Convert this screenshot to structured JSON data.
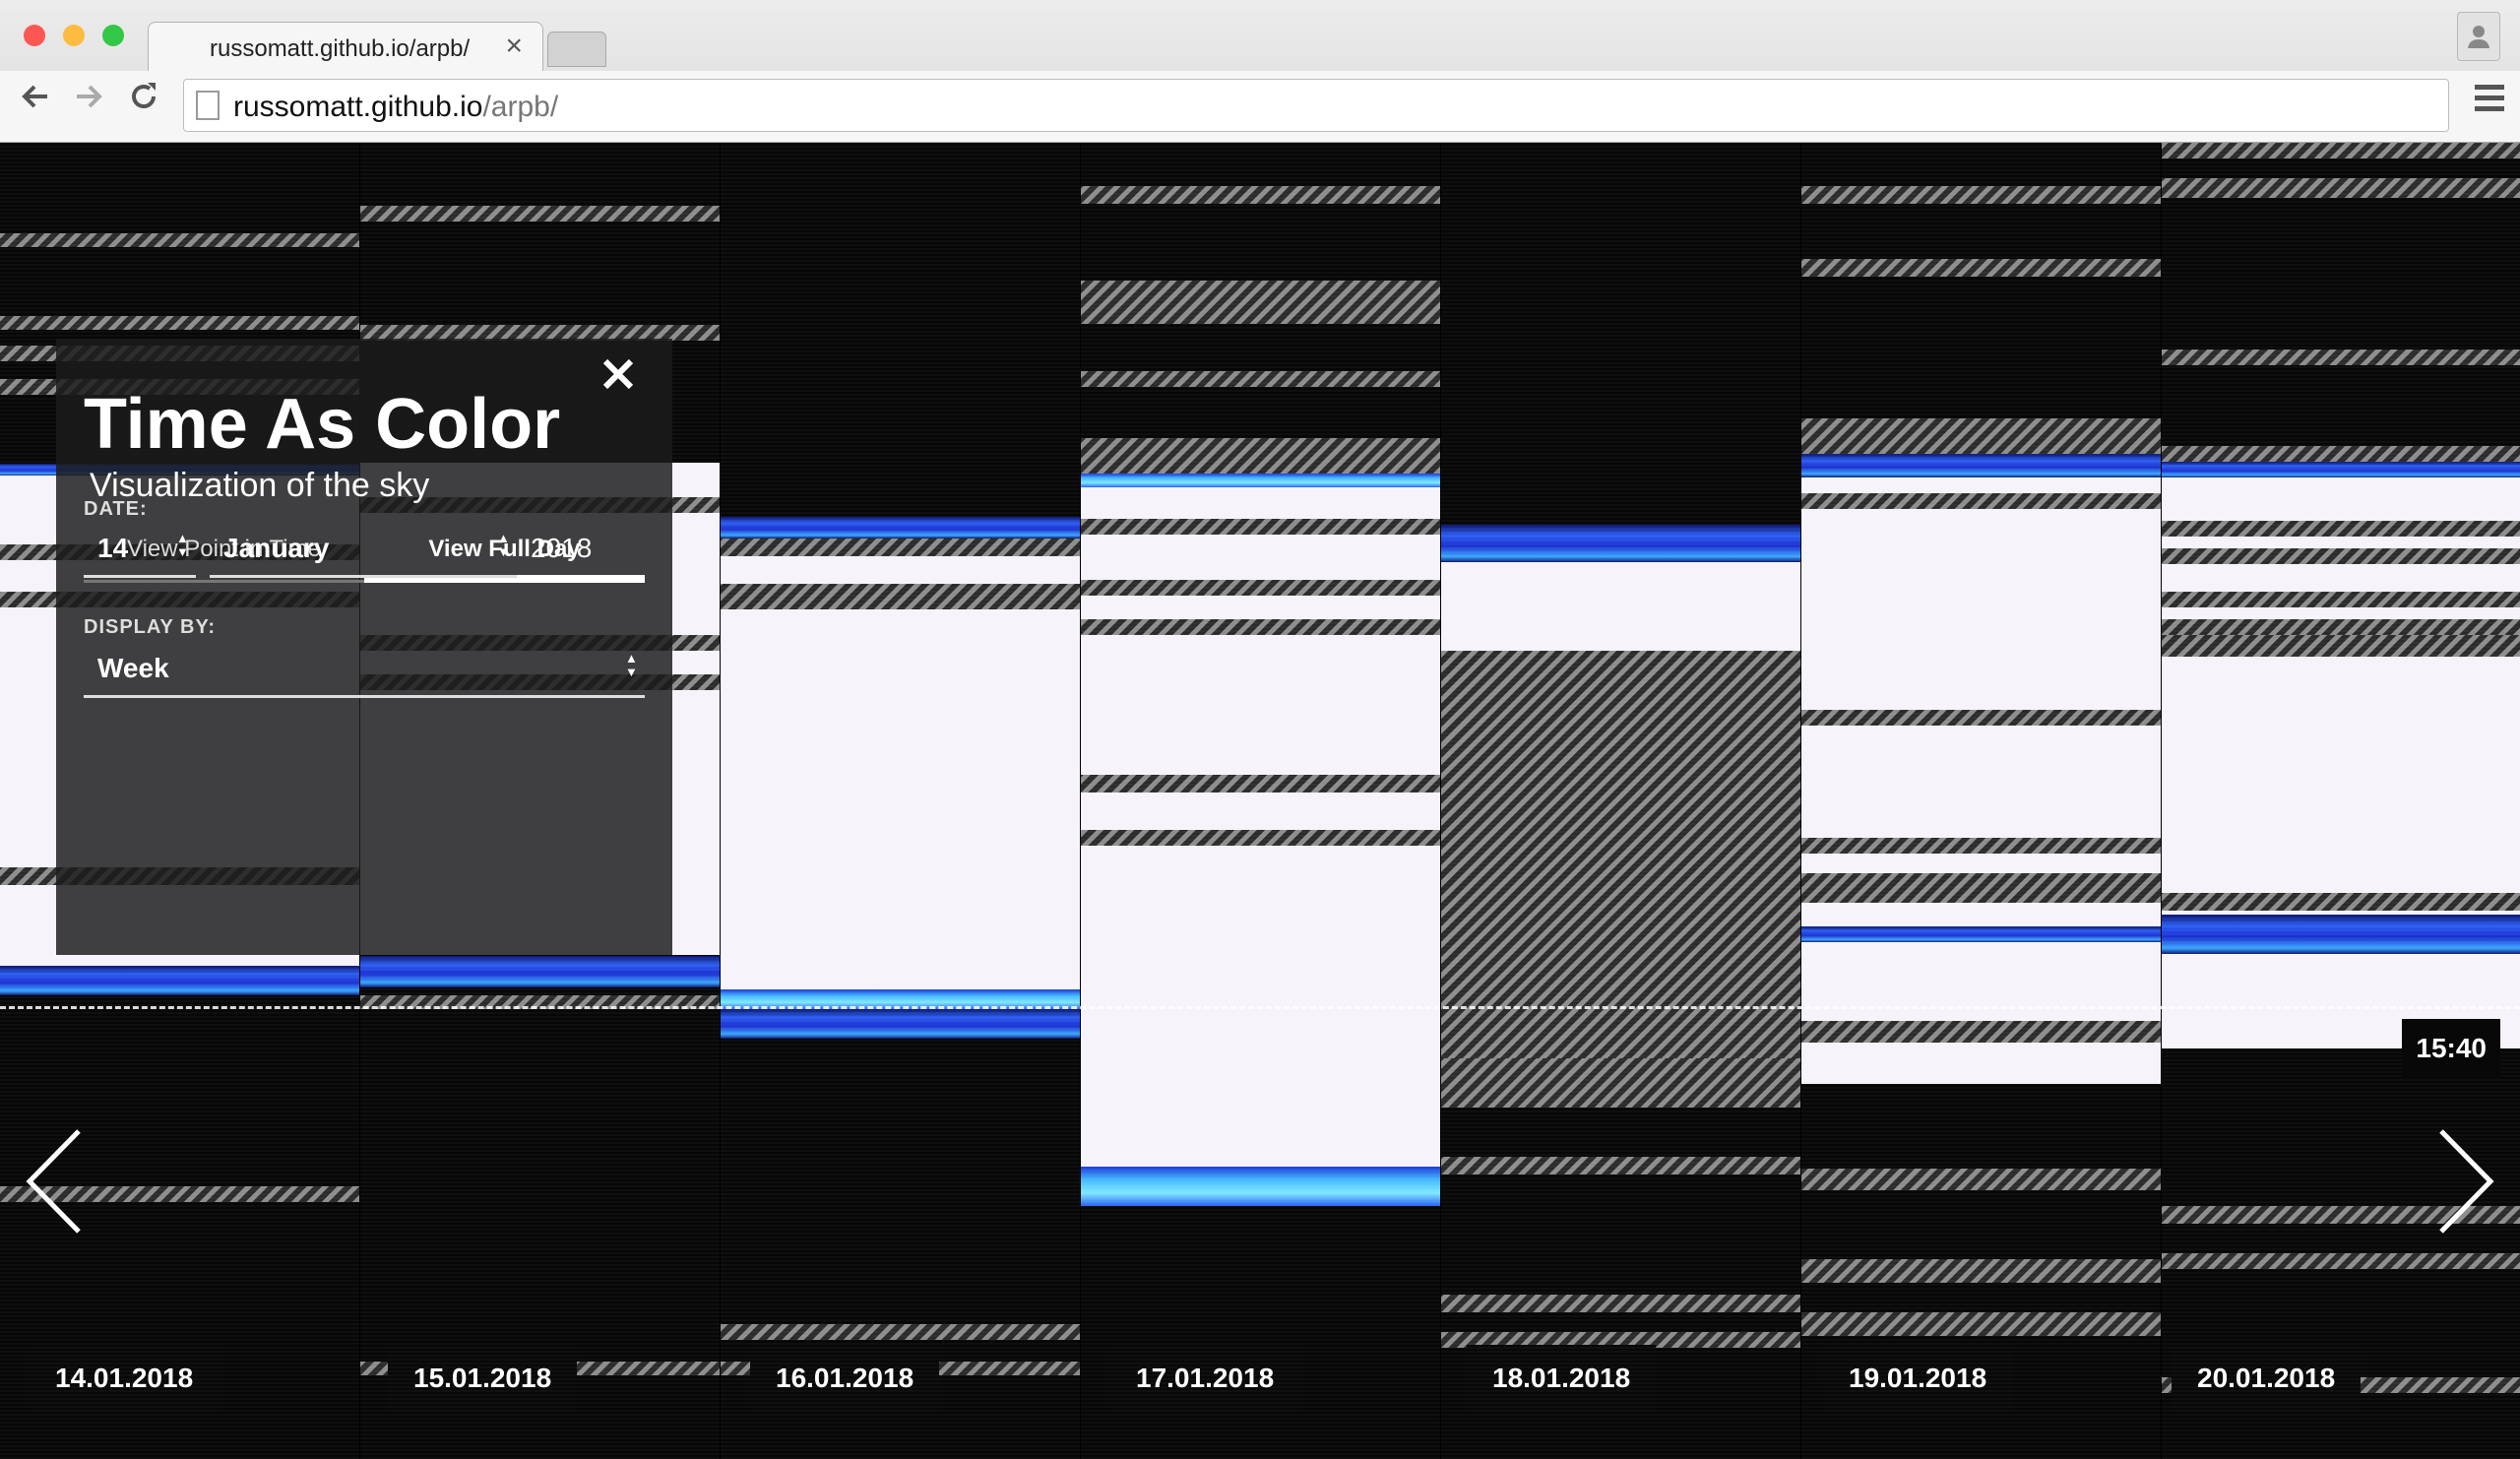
{
  "browser": {
    "tab_title": "russomatt.github.io/arpb/",
    "tab_close": "×",
    "url_host": "russomatt.github.io",
    "url_path": "/arpb/",
    "traffic_lights": {
      "close": "#fc5753",
      "minimize": "#fdbc40",
      "zoom": "#33c748"
    }
  },
  "panel": {
    "title": "Time As Color",
    "subtitle": "Visualization of the sky",
    "tabs": [
      {
        "label": "View Point in Time",
        "active": false
      },
      {
        "label": "View Full Day",
        "active": true
      }
    ],
    "date_label": "DATE:",
    "day_value": "14",
    "month_value": "January",
    "year_value": "2018",
    "display_label": "DISPLAY BY:",
    "display_value": "Week"
  },
  "timeline": {
    "current_time": "15:40",
    "days": [
      "14.01.2018",
      "15.01.2018",
      "16.01.2018",
      "17.01.2018",
      "18.01.2018",
      "19.01.2018",
      "20.01.2018"
    ]
  },
  "colors": {
    "sky_day": "#f7f3fb",
    "twilight_blue": "#2c5ef2",
    "missing_hatch": "#8d8d8d"
  }
}
